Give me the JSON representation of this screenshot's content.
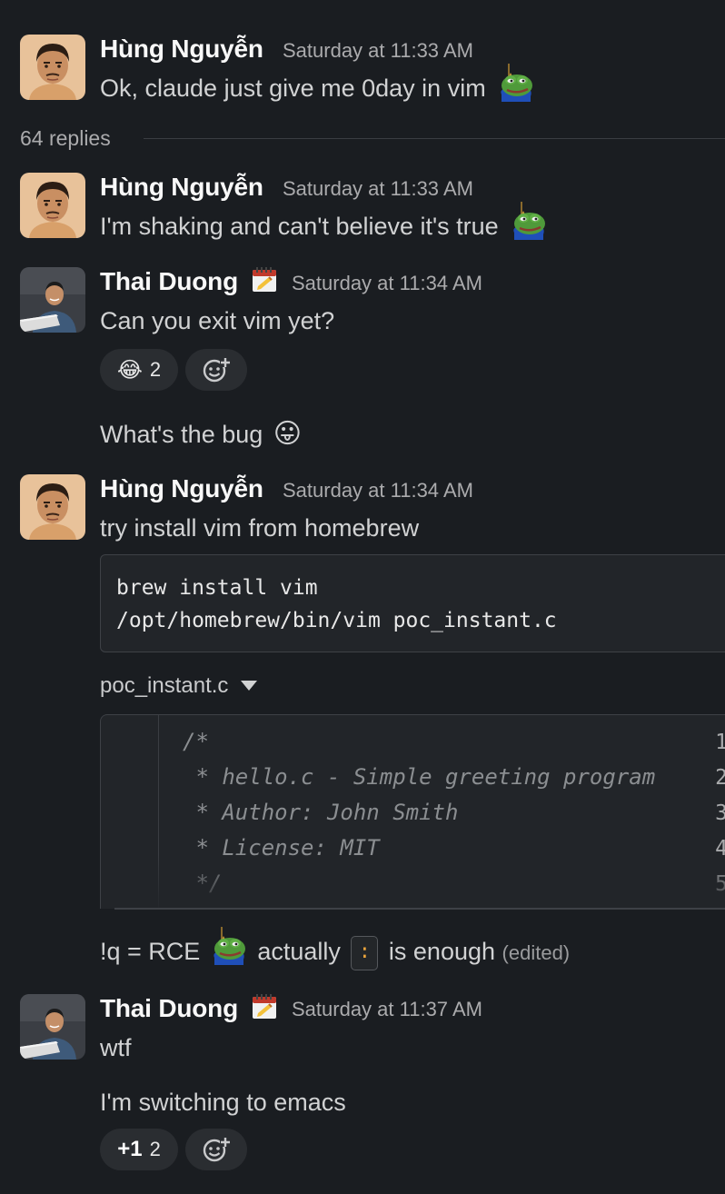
{
  "thread": {
    "root": {
      "author": "Hùng Nguyễn",
      "time": "Saturday at 11:33 AM",
      "text": "Ok, claude just give me 0day in vim",
      "emoji": "pepe-icon"
    },
    "replies_label": "64 replies",
    "messages": [
      {
        "author": "Hùng Nguyễn",
        "time": "Saturday at 11:33 AM",
        "text": "I'm shaking and can't believe it's true",
        "emoji": "pepe-icon"
      },
      {
        "author": "Thai Duong",
        "status_emoji": "calendar-icon",
        "time": "Saturday at 11:34 AM",
        "text": "Can you exit vim yet?",
        "reactions": [
          {
            "emoji": "😂",
            "count": "2"
          }
        ]
      },
      {
        "text": "What's the bug",
        "emoji": "😛"
      },
      {
        "author": "Hùng Nguyễn",
        "time": "Saturday at 11:34 AM",
        "text": "try install vim from homebrew",
        "code": "brew install vim\n/opt/homebrew/bin/vim poc_instant.c",
        "file_name": "poc_instant.c",
        "snippet_lines": [
          {
            "n": "1",
            "code": "/*"
          },
          {
            "n": "2",
            "code": " * hello.c - Simple greeting program"
          },
          {
            "n": "3",
            "code": " * Author: John Smith"
          },
          {
            "n": "4",
            "code": " * License: MIT"
          },
          {
            "n": "5",
            "code": " */"
          }
        ],
        "followup_part1": "!q = RCE",
        "followup_part2": "actually",
        "followup_key": ":",
        "followup_part3": "is enough",
        "edited": "(edited)"
      },
      {
        "author": "Thai Duong",
        "status_emoji": "calendar-icon",
        "time": "Saturday at 11:37 AM",
        "text": "wtf",
        "text2": "I'm switching to emacs",
        "reactions": [
          {
            "emoji": "+1",
            "count": "2"
          }
        ]
      }
    ]
  },
  "colors": {
    "background": "#1a1d21",
    "text": "#d1d2d3",
    "author": "#f8f8f8",
    "timestamp": "#ababad",
    "code_bg": "#222529",
    "reaction_bg": "#2a2d31"
  }
}
